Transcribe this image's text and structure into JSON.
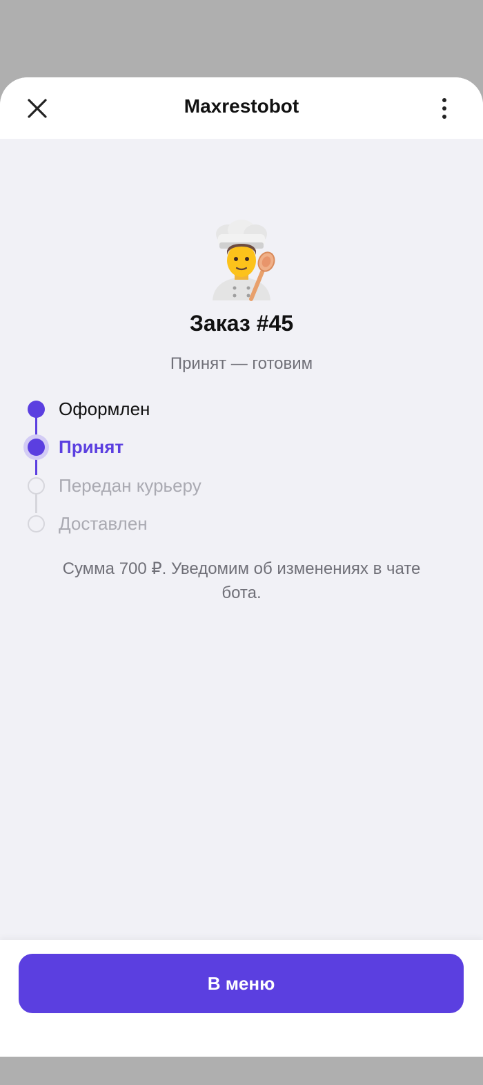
{
  "header": {
    "title": "Maxrestobot",
    "close_icon": "close-icon",
    "more_icon": "more-vertical-icon"
  },
  "hero": {
    "icon": "cook-emoji-icon"
  },
  "order": {
    "title": "Заказ #45",
    "status": "Принят — готовим"
  },
  "steps": [
    {
      "label": "Оформлен",
      "state": "done"
    },
    {
      "label": "Принят",
      "state": "active"
    },
    {
      "label": "Передан курьеру",
      "state": "pending"
    },
    {
      "label": "Доставлен",
      "state": "pending"
    }
  ],
  "note": "Сумма 700 ₽. Уведомим об изменениях в чате бота.",
  "footer": {
    "menu_button": "В меню"
  },
  "colors": {
    "accent": "#5b3fe0",
    "accent_soft": "#d3ccf5",
    "pending": "#d6d6dc",
    "background": "#f1f1f6"
  }
}
